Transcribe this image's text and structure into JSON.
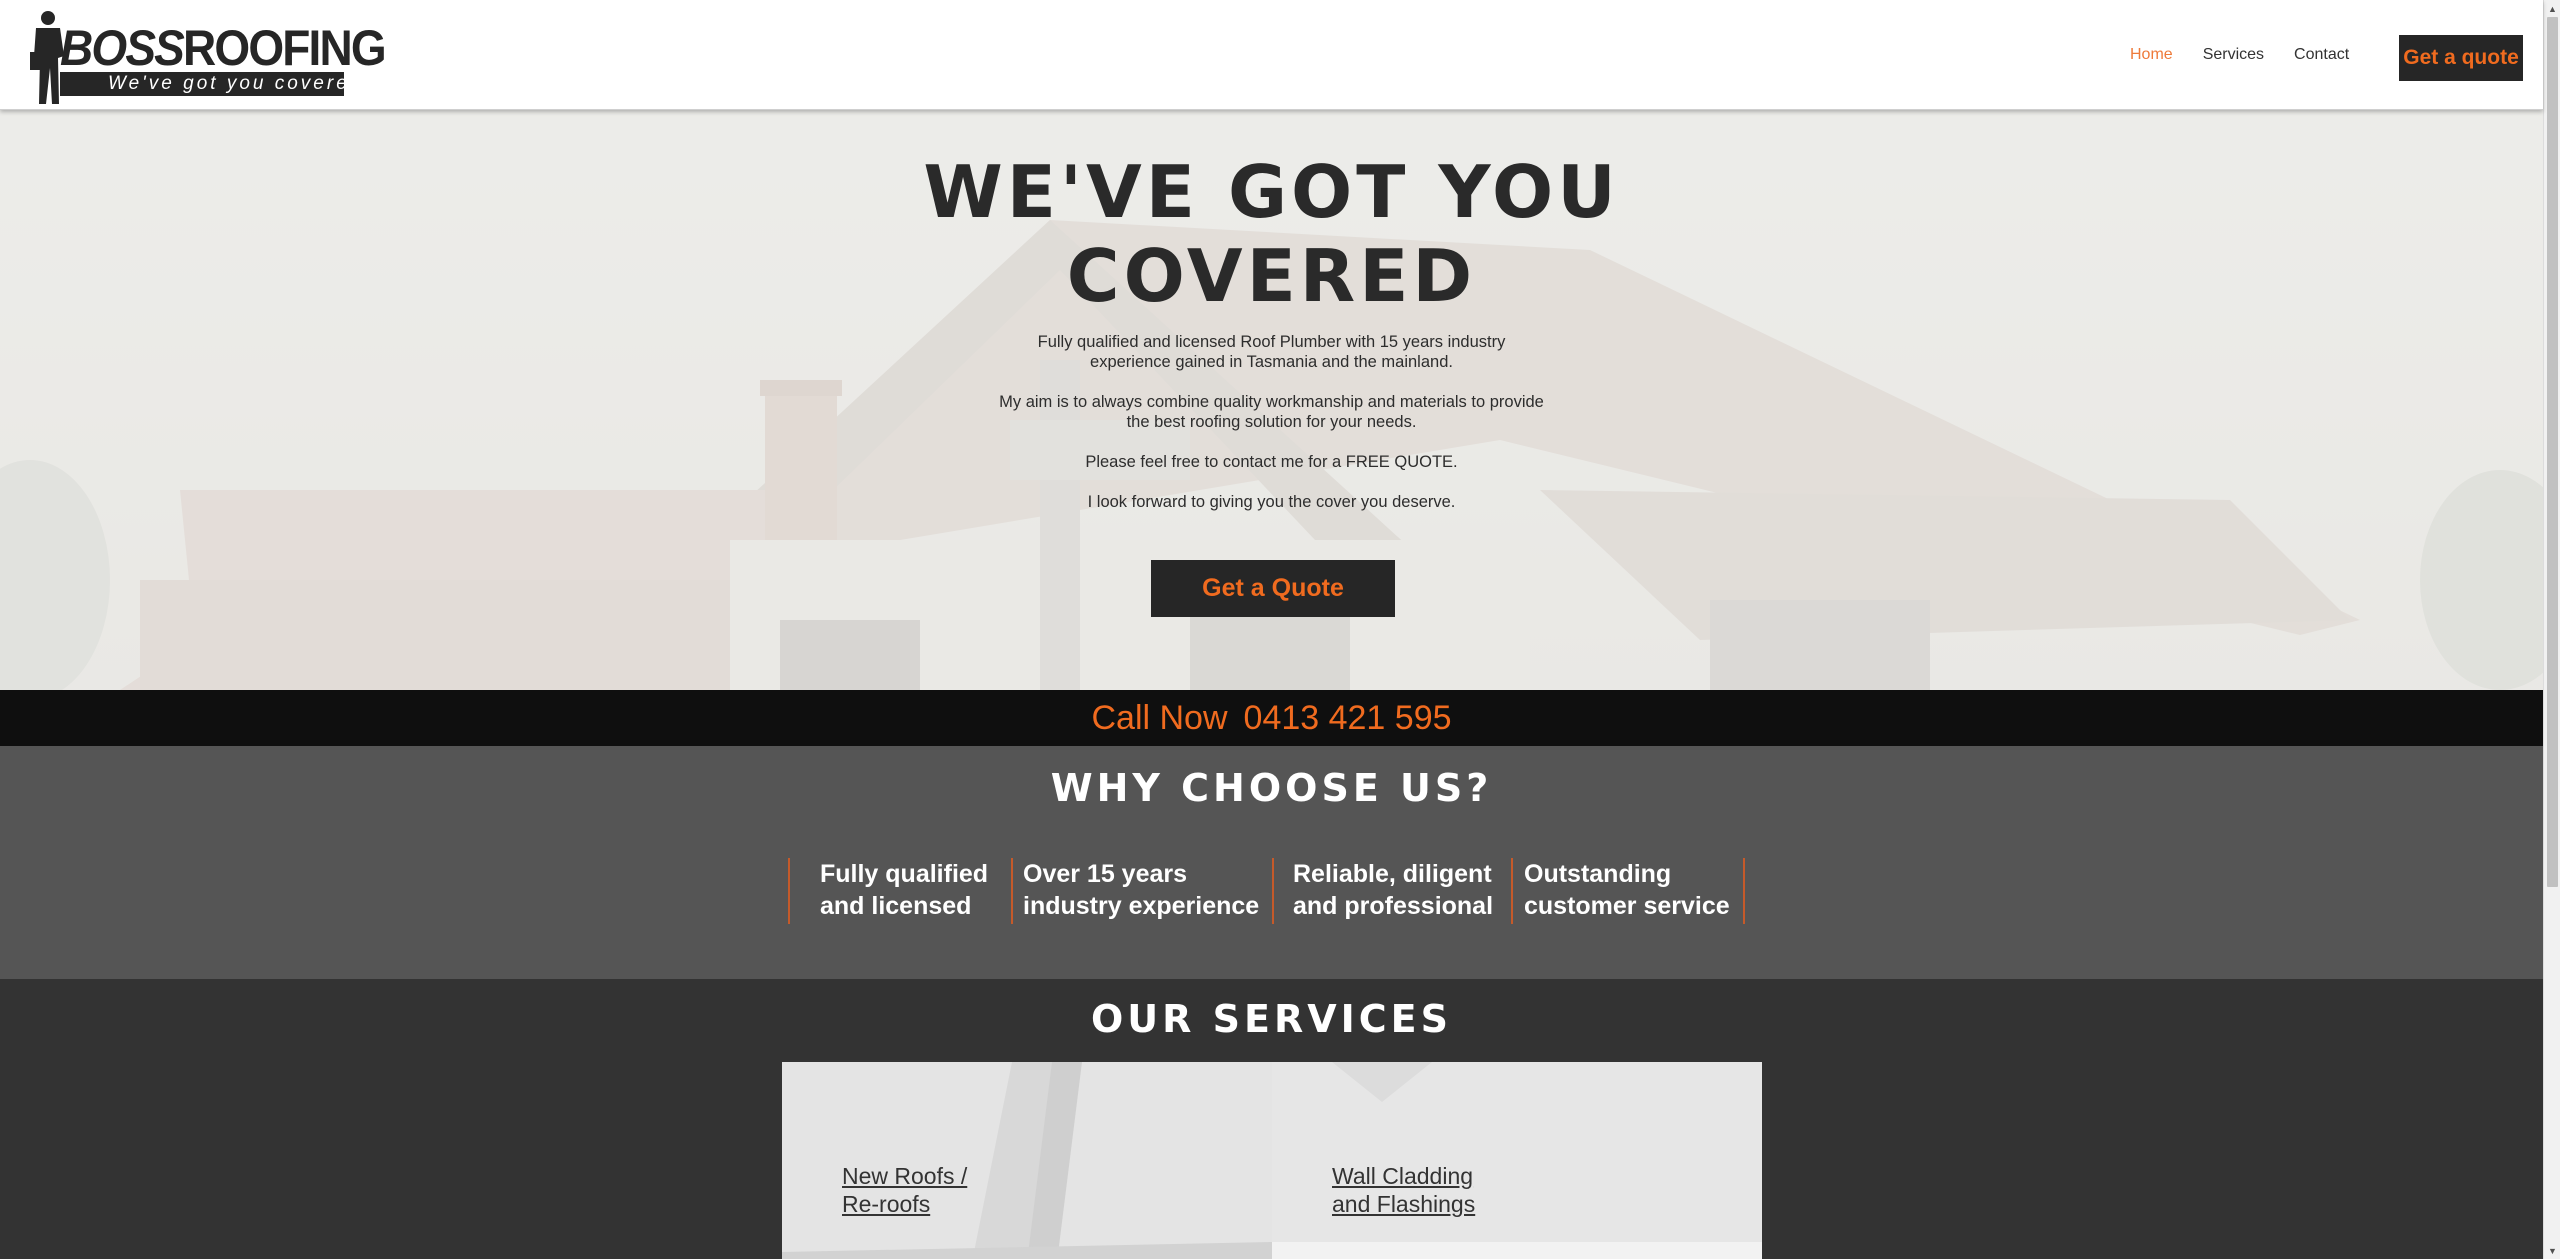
{
  "header": {
    "logo": {
      "word_left": "BOSS",
      "word_right": "ROOFING",
      "tagline": "We've got you covered"
    },
    "nav": [
      {
        "label": "Home",
        "active": true
      },
      {
        "label": "Services",
        "active": false
      },
      {
        "label": "Contact",
        "active": false
      }
    ],
    "cta_label": "Get a quote"
  },
  "hero": {
    "title_line1": "WE'VE GOT YOU",
    "title_line2": "COVERED",
    "para1_line1": "Fully qualified and licensed Roof Plumber with 15 years industry",
    "para1_line2": "experience gained in Tasmania and the mainland.",
    "para2_line1": "My aim is to always combine quality workmanship and materials to provide",
    "para2_line2": "the best roofing solution for your needs.",
    "para3": "Please feel free to contact me for a FREE QUOTE.",
    "para4": "I look forward to giving you the cover you deserve.",
    "button_label": "Get a Quote"
  },
  "callbar": {
    "label": "Call Now",
    "phone": "0413 421 595"
  },
  "why": {
    "title": "WHY CHOOSE US?",
    "items": [
      {
        "line1": "Fully qualified",
        "line2": "and licensed"
      },
      {
        "line1": "Over 15 years",
        "line2": "industry experience"
      },
      {
        "line1": "Reliable, diligent",
        "line2": "and professional"
      },
      {
        "line1": "Outstanding",
        "line2": "customer service"
      }
    ]
  },
  "services": {
    "title": "OUR SERVICES",
    "cards": [
      {
        "line1": "New Roofs /",
        "line2": "Re-roofs"
      },
      {
        "line1": "Wall Cladding",
        "line2": "and Flashings"
      }
    ]
  },
  "colors": {
    "accent": "#f06b1f",
    "dark": "#262626",
    "why_bg": "#555555",
    "services_bg": "#333333",
    "callbar_bg": "#0f0f0f"
  }
}
